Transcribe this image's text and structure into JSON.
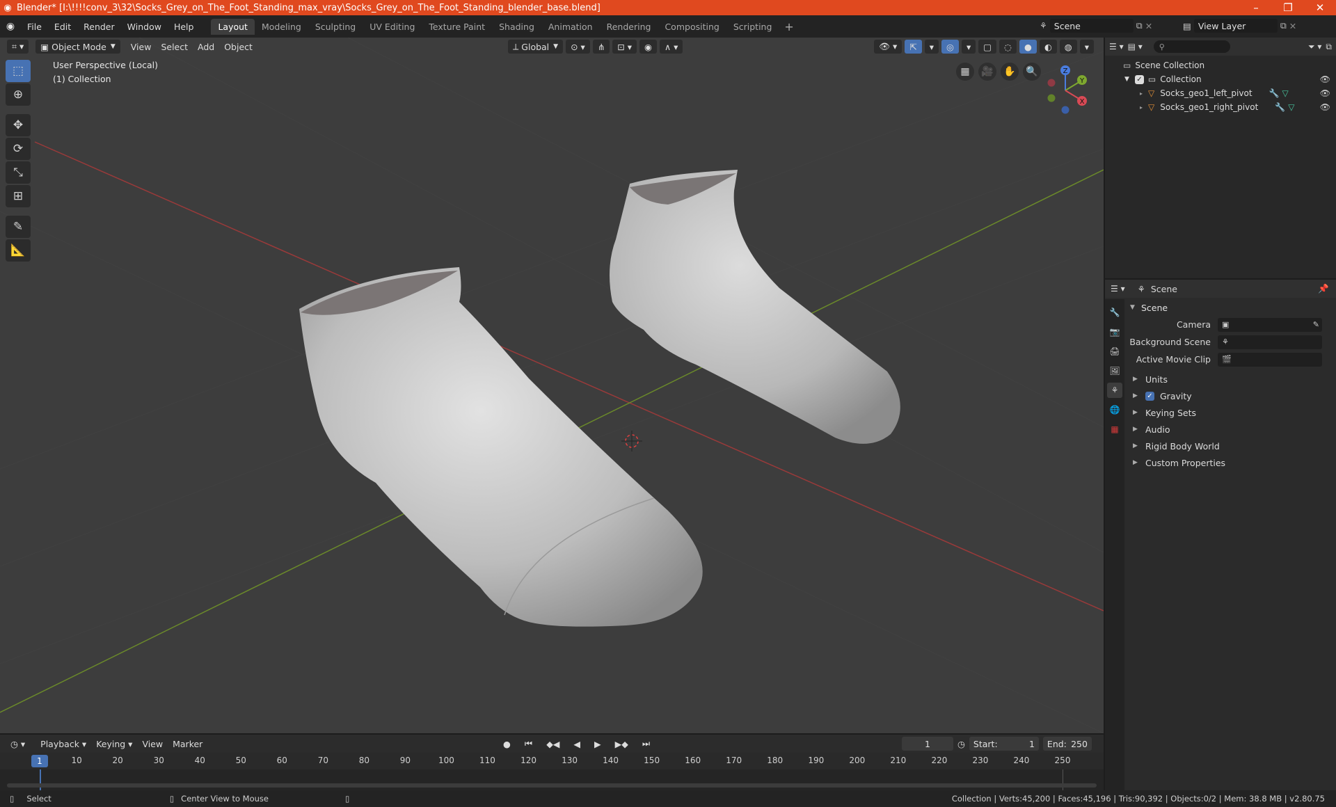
{
  "titlebar": {
    "title": "Blender* [I:\\!!!!conv_3\\32\\Socks_Grey_on_The_Foot_Standing_max_vray\\Socks_Grey_on_The_Foot_Standing_blender_base.blend]",
    "minimize": "–",
    "maximize": "❐",
    "close": "✕"
  },
  "menu": [
    "File",
    "Edit",
    "Render",
    "Window",
    "Help"
  ],
  "workspaces": [
    "Layout",
    "Modeling",
    "Sculpting",
    "UV Editing",
    "Texture Paint",
    "Shading",
    "Animation",
    "Rendering",
    "Compositing",
    "Scripting"
  ],
  "scene": {
    "label": "Scene"
  },
  "view_layer": {
    "label": "View Layer"
  },
  "viewport": {
    "mode": "Object Mode",
    "menus": [
      "View",
      "Select",
      "Add",
      "Object"
    ],
    "orientation": "Global",
    "info_line1": "User Perspective (Local)",
    "info_line2": "(1) Collection",
    "gizmo": {
      "x": "X",
      "y": "Y",
      "z": "Z"
    }
  },
  "outliner": {
    "root": "Scene Collection",
    "collection": "Collection",
    "objects": [
      "Socks_geo1_left_pivot",
      "Socks_geo1_right_pivot"
    ]
  },
  "properties": {
    "header": "Scene",
    "panel": "Scene",
    "fields": [
      {
        "label": "Camera"
      },
      {
        "label": "Background Scene"
      },
      {
        "label": "Active Movie Clip"
      }
    ],
    "subpanels": [
      "Units",
      "Gravity",
      "Keying Sets",
      "Audio",
      "Rigid Body World",
      "Custom Properties"
    ]
  },
  "timeline": {
    "menus": [
      "Playback",
      "Keying",
      "View",
      "Marker"
    ],
    "current_frame": "1",
    "start_label": "Start:",
    "start": "1",
    "end_label": "End:",
    "end": "250",
    "ticks": [
      "10",
      "20",
      "30",
      "40",
      "50",
      "60",
      "70",
      "80",
      "90",
      "100",
      "110",
      "120",
      "130",
      "140",
      "150",
      "160",
      "170",
      "180",
      "190",
      "200",
      "210",
      "220",
      "230",
      "240",
      "250"
    ]
  },
  "statusbar": {
    "select": "Select",
    "center": "Center View to Mouse",
    "stats": "Collection | Verts:45,200 | Faces:45,196 | Tris:90,392 | Objects:0/2 | Mem: 38.8 MB | v2.80.75"
  }
}
